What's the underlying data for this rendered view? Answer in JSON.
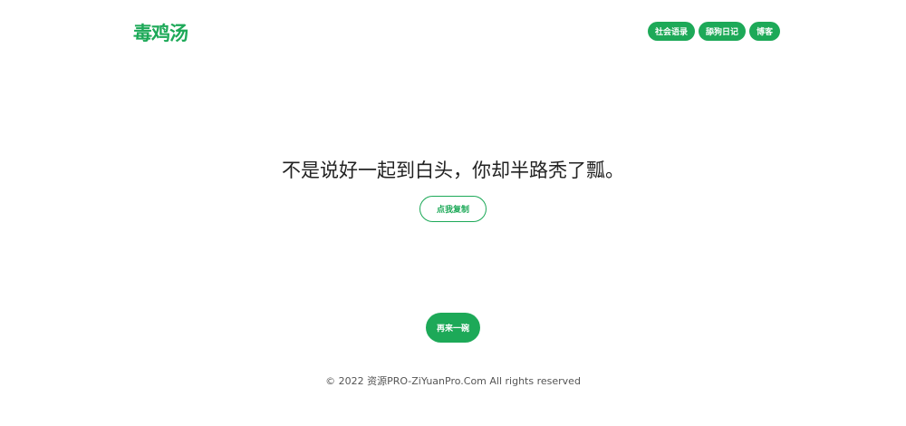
{
  "header": {
    "logo_text": "毒鸡汤",
    "nav": [
      {
        "label": "社会语录"
      },
      {
        "label": "舔狗日记"
      },
      {
        "label": "博客"
      }
    ]
  },
  "main": {
    "quote": "不是说好一起到白头，你却半路秃了瓢。",
    "copy_button": "点我复制",
    "again_button": "再来一碗"
  },
  "footer": {
    "text": "© 2022 资源PRO-ZiYuanPro.Com All rights reserved"
  },
  "colors": {
    "accent": "#1da958",
    "text": "#222222",
    "background": "#ffffff"
  }
}
